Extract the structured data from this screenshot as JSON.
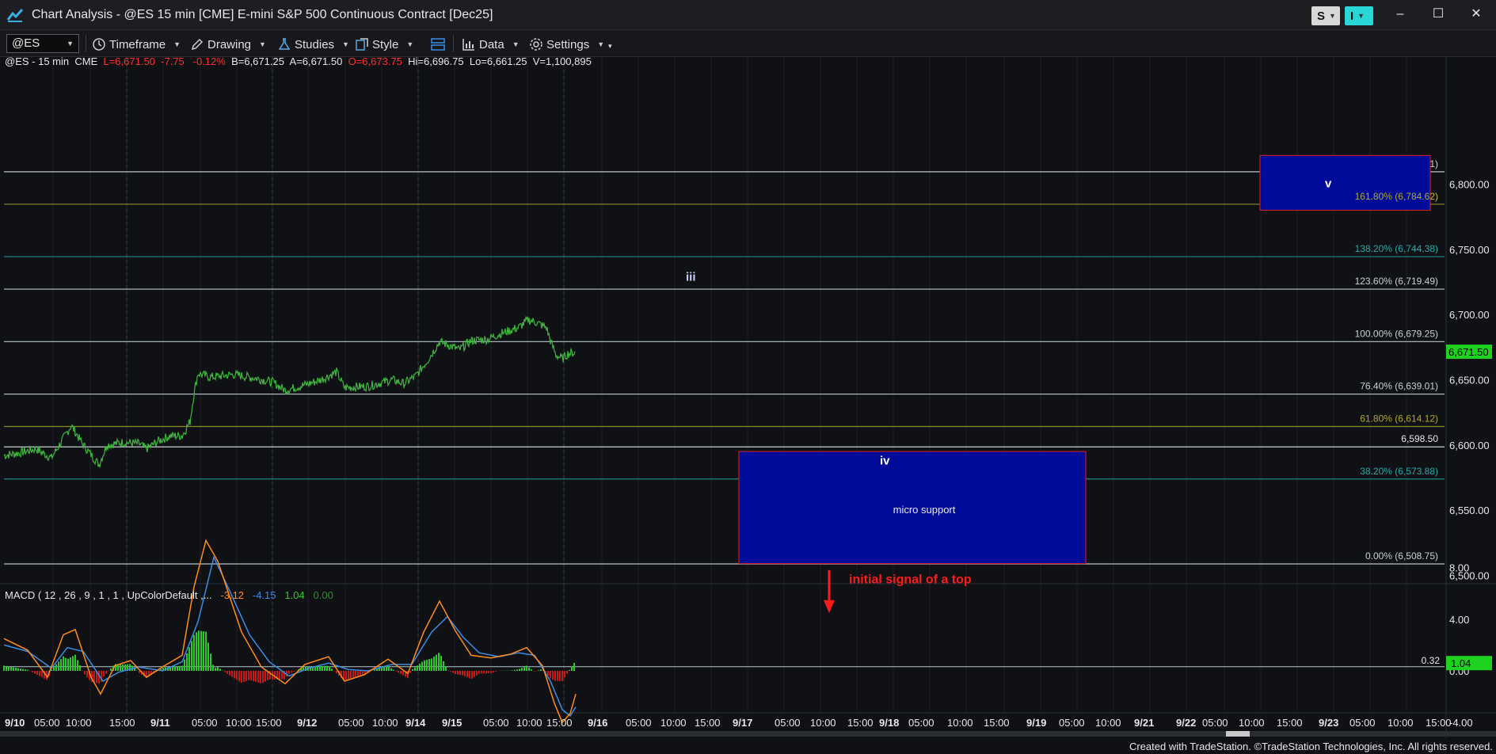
{
  "window": {
    "title": "Chart Analysis - @ES 15 min [CME] E-mini S&P 500 Continuous Contract [Dec25]",
    "s_button": "S",
    "i_button": "I",
    "minimize": "–",
    "maximize": "☐",
    "close": "✕"
  },
  "toolbar": {
    "symbol": "@ES",
    "timeframe": "Timeframe",
    "drawing": "Drawing",
    "studies": "Studies",
    "style": "Style",
    "data": "Data",
    "settings": "Settings"
  },
  "status": {
    "symbol_interval": "@ES - 15 min",
    "exchange": "CME",
    "last": "L=6,671.50",
    "change": "-7.75",
    "change_pct": "-0.12%",
    "bid": "B=6,671.25",
    "ask": "A=6,671.50",
    "open": "O=6,673.75",
    "high": "Hi=6,696.75",
    "low": "Lo=6,661.25",
    "volume": "V=1,100,895"
  },
  "colors": {
    "background": "#0f1114",
    "price_line": "#3db83d",
    "box_fill": "#000c99",
    "box_border": "#e02020",
    "annotation_red": "#ff1a1a",
    "macd_line": "#ff8c1a",
    "signal_line": "#3a8ee6",
    "hist_up": "#2ec82e",
    "hist_down": "#c21a1a"
  },
  "chart_data": [
    {
      "type": "line",
      "name": "price",
      "x": [
        "9/10",
        "9/11",
        "9/12",
        "9/14",
        "9/15",
        "9/16"
      ],
      "ylim": [
        6450,
        6850
      ],
      "y_ticks": [
        "6,800.00",
        "6,750.00",
        "6,700.00",
        "6,650.00",
        "6,600.00",
        "6,550.00",
        "6,500.00"
      ],
      "x_tick_labels": [
        "9/10",
        "05:00",
        "10:00",
        "15:00",
        "9/11",
        "05:00",
        "10:00",
        "15:00",
        "9/12",
        "05:00",
        "10:00",
        "9/14",
        "9/15",
        "05:00",
        "10:00",
        "15:00",
        "9/16",
        "05:00",
        "10:00",
        "15:00",
        "9/17",
        "05:00",
        "10:00",
        "15:00",
        "9/18",
        "05:00",
        "10:00",
        "15:00",
        "9/19",
        "05:00",
        "10:00",
        "9/21",
        "9/22",
        "05:00",
        "10:00",
        "15:00",
        "9/23",
        "05:00",
        "10:00",
        "15:00"
      ],
      "path": [
        [
          0,
          6592
        ],
        [
          20,
          6594
        ],
        [
          40,
          6597
        ],
        [
          60,
          6590
        ],
        [
          75,
          6605
        ],
        [
          85,
          6615
        ],
        [
          100,
          6600
        ],
        [
          120,
          6585
        ],
        [
          130,
          6600
        ],
        [
          150,
          6602
        ],
        [
          170,
          6601
        ],
        [
          180,
          6597
        ],
        [
          195,
          6603
        ],
        [
          210,
          6607
        ],
        [
          225,
          6607
        ],
        [
          235,
          6618
        ],
        [
          240,
          6640
        ],
        [
          245,
          6655
        ],
        [
          260,
          6652
        ],
        [
          290,
          6654
        ],
        [
          320,
          6651
        ],
        [
          340,
          6648
        ],
        [
          355,
          6642
        ],
        [
          380,
          6646
        ],
        [
          400,
          6650
        ],
        [
          420,
          6656
        ],
        [
          430,
          6644
        ],
        [
          460,
          6645
        ],
        [
          490,
          6650
        ],
        [
          505,
          6647
        ],
        [
          520,
          6653
        ],
        [
          535,
          6665
        ],
        [
          550,
          6679
        ],
        [
          560,
          6677
        ],
        [
          575,
          6673
        ],
        [
          590,
          6680
        ],
        [
          610,
          6681
        ],
        [
          630,
          6686
        ],
        [
          650,
          6690
        ],
        [
          662,
          6696
        ],
        [
          672,
          6694
        ],
        [
          685,
          6690
        ],
        [
          690,
          6680
        ],
        [
          697,
          6669
        ],
        [
          705,
          6666
        ],
        [
          712,
          6670
        ],
        [
          722,
          6671
        ]
      ],
      "fib_levels": [
        {
          "label": "176.40% (6,809.51)",
          "value": 6809.51,
          "color": "#b8c4cc"
        },
        {
          "label": "161.80% (6,784.62)",
          "value": 6784.62,
          "color": "#8a8a2a"
        },
        {
          "label": "138.20% (6,744.38)",
          "value": 6744.38,
          "color": "#1f8a8a"
        },
        {
          "label": "123.60% (6,719.49)",
          "value": 6719.49,
          "color": "#b8c4cc"
        },
        {
          "label": "100.00% (6,679.25)",
          "value": 6679.25,
          "color": "#b8c4cc"
        },
        {
          "label": "76.40% (6,639.01)",
          "value": 6639.01,
          "color": "#b8c4cc"
        },
        {
          "label": "61.80% (6,614.12)",
          "value": 6614.12,
          "color": "#8a8a2a"
        },
        {
          "label": "38.20% (6,573.88)",
          "value": 6573.88,
          "color": "#1f8a8a"
        },
        {
          "label": "0.00% (6,508.75)",
          "value": 6508.75,
          "color": "#b8c4cc"
        }
      ],
      "horizontal_line": {
        "label": "6,598.50",
        "value": 6598.5
      },
      "last_price_tag": "6,671.50",
      "annotations": {
        "wave_iii": "iii",
        "wave_iv": "iv",
        "wave_v": "v",
        "micro_support": "micro support",
        "initial_signal": "initial signal of a top"
      }
    },
    {
      "type": "line",
      "name": "MACD",
      "legend": "MACD ( 12 , 26 , 9 , 1 , 1 , UpColorDefault ,...",
      "legend_values": [
        "-3.12",
        "-4.15",
        "1.04",
        "0.00"
      ],
      "ylim": [
        -6,
        11
      ],
      "y_ticks": [
        "8.00",
        "4.00",
        "0.00",
        "-4.00"
      ],
      "zero_line_label": "0.32",
      "hist_tag": "1.04",
      "macd_path": [
        [
          0,
          2.5
        ],
        [
          30,
          1.6
        ],
        [
          55,
          -0.5
        ],
        [
          75,
          2.8
        ],
        [
          90,
          3.2
        ],
        [
          110,
          -0.5
        ],
        [
          122,
          -1.8
        ],
        [
          140,
          0.4
        ],
        [
          160,
          0.8
        ],
        [
          180,
          -0.5
        ],
        [
          200,
          0.3
        ],
        [
          225,
          1.2
        ],
        [
          240,
          6.5
        ],
        [
          255,
          10.1
        ],
        [
          270,
          8.5
        ],
        [
          300,
          3.0
        ],
        [
          325,
          0.3
        ],
        [
          355,
          -1.0
        ],
        [
          380,
          0.5
        ],
        [
          410,
          1.1
        ],
        [
          430,
          -0.8
        ],
        [
          455,
          -0.3
        ],
        [
          485,
          0.9
        ],
        [
          510,
          -0.2
        ],
        [
          530,
          3.0
        ],
        [
          550,
          5.4
        ],
        [
          570,
          3.1
        ],
        [
          590,
          1.2
        ],
        [
          615,
          1.0
        ],
        [
          640,
          1.3
        ],
        [
          660,
          1.8
        ],
        [
          680,
          0.4
        ],
        [
          695,
          -2.5
        ],
        [
          705,
          -4.0
        ],
        [
          715,
          -3.3
        ],
        [
          722,
          -1.8
        ]
      ],
      "signal_path": [
        [
          0,
          2.0
        ],
        [
          30,
          1.5
        ],
        [
          60,
          0.2
        ],
        [
          80,
          1.8
        ],
        [
          100,
          1.5
        ],
        [
          125,
          -0.8
        ],
        [
          145,
          -0.1
        ],
        [
          170,
          0.3
        ],
        [
          200,
          0.0
        ],
        [
          225,
          0.7
        ],
        [
          245,
          3.8
        ],
        [
          265,
          8.8
        ],
        [
          285,
          6.2
        ],
        [
          310,
          2.8
        ],
        [
          335,
          0.7
        ],
        [
          360,
          -0.4
        ],
        [
          385,
          0.2
        ],
        [
          410,
          0.6
        ],
        [
          435,
          0.1
        ],
        [
          460,
          0.0
        ],
        [
          490,
          0.5
        ],
        [
          515,
          0.5
        ],
        [
          540,
          3.0
        ],
        [
          560,
          4.2
        ],
        [
          580,
          2.6
        ],
        [
          600,
          1.4
        ],
        [
          625,
          1.1
        ],
        [
          650,
          1.4
        ],
        [
          670,
          1.2
        ],
        [
          690,
          -0.8
        ],
        [
          705,
          -3.0
        ],
        [
          715,
          -3.5
        ],
        [
          722,
          -2.8
        ]
      ]
    }
  ],
  "footer": "Created with TradeStation. ©TradeStation Technologies, Inc. All rights reserved."
}
